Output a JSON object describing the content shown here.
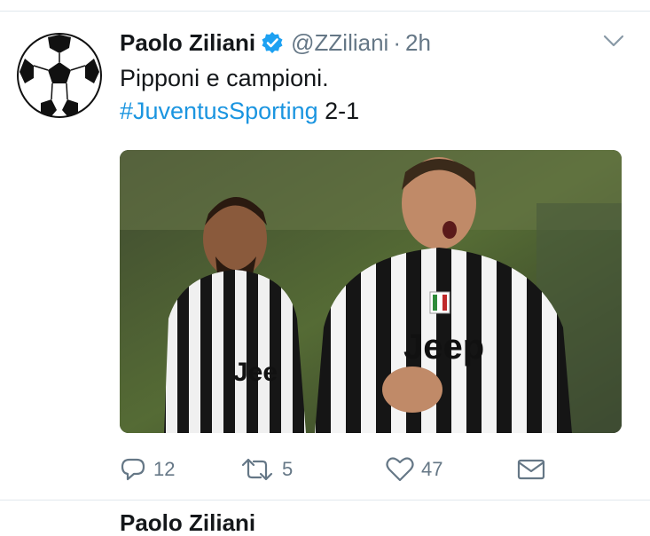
{
  "tweet": {
    "display_name": "Paolo Ziliani",
    "handle": "@ZZiliani",
    "separator": "·",
    "time": "2h",
    "text_line1": "Pipponi e campioni.",
    "hashtag": "#JuventusSporting",
    "score": " 2-1",
    "media_kit_text_left": "Jee",
    "media_kit_text_right": "Jeep",
    "icons": {
      "avatar": "soccer-ball-icon",
      "verified": "verified-badge-icon",
      "menu": "chevron-down-icon",
      "reply": "reply-icon",
      "retweet": "retweet-icon",
      "like": "heart-icon",
      "dm": "envelope-icon"
    },
    "colors": {
      "link": "#1b95e0",
      "muted": "#657786",
      "text": "#14171a"
    }
  },
  "actions": {
    "reply_count": "12",
    "retweet_count": "5",
    "like_count": "47"
  },
  "next_tweet": {
    "display_name": "Paolo Ziliani"
  }
}
